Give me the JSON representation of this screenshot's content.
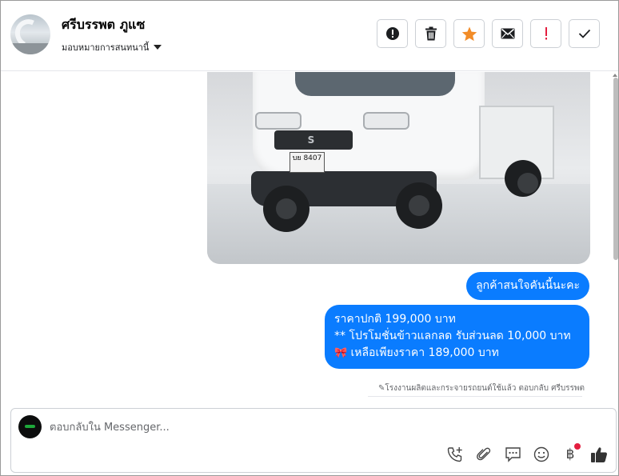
{
  "header": {
    "contact_name": "ศรีบรรพต ภูแซ",
    "assign_label": "มอบหมายการสนทนานี้",
    "actions": [
      {
        "name": "exclamation-circle-icon",
        "label": "Report"
      },
      {
        "name": "trash-icon",
        "label": "Delete"
      },
      {
        "name": "star-icon",
        "label": "Star",
        "color": "#f28c28"
      },
      {
        "name": "envelope-icon",
        "label": "Mark unread"
      },
      {
        "name": "exclamation-icon",
        "label": "Spam",
        "color": "#e41e3f"
      },
      {
        "name": "checkmark-icon",
        "label": "Done"
      }
    ]
  },
  "conversation": {
    "photo_plate": "บย 8407",
    "messages": [
      {
        "text": "ลูกค้าสนใจคันนี้นะคะ"
      },
      {
        "lines": [
          "ราคาปกติ 199,000 บาท",
          "** โปรโมชั่นข้าวแลกลด รับส่วนลด 10,000 บาท",
          "เหลือเพียงราคา 189,000 บาท"
        ],
        "emoji": "🎀"
      }
    ],
    "meta": "โรงงานผลิตและกระจายรถยนต์ใช้แล้ว ตอบกลับ ศรีบรรพต"
  },
  "composer": {
    "placeholder": "ตอบกลับใน Messenger...",
    "tools": [
      "phone-plus-icon",
      "paperclip-icon",
      "chat-bubble-icon",
      "smiley-icon",
      "baht-icon",
      "thumbs-up-icon"
    ],
    "baht_symbol": "฿"
  },
  "colors": {
    "bubble": "#0a7cff",
    "star": "#f28c28",
    "alert": "#e41e3f"
  }
}
